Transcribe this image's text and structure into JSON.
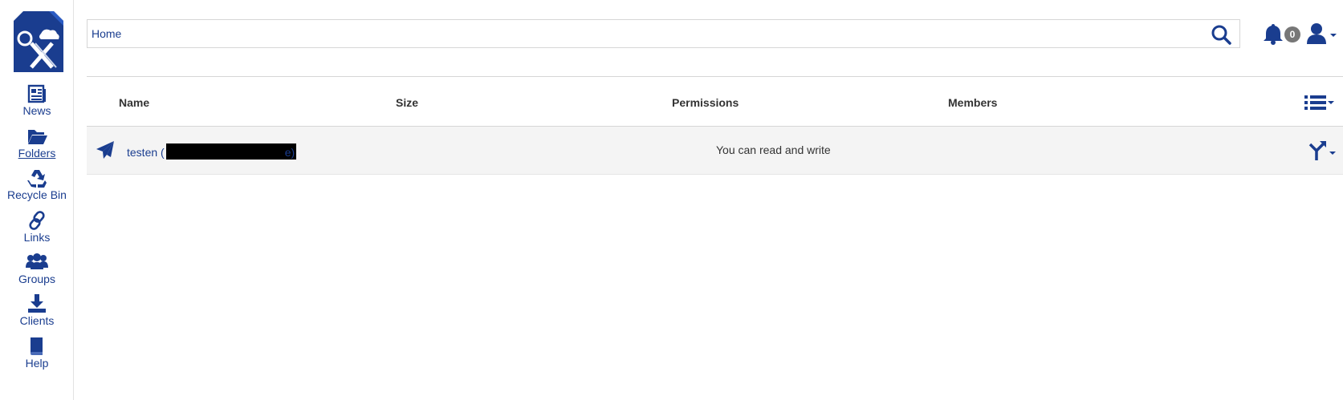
{
  "sidebar": {
    "logo_alt": "CX logo",
    "items": [
      {
        "label": "News",
        "icon": "news-icon"
      },
      {
        "label": "Folders",
        "icon": "folder-icon",
        "active": true
      },
      {
        "label": "Recycle Bin",
        "icon": "recycle-icon"
      },
      {
        "label": "Links",
        "icon": "link-icon"
      },
      {
        "label": "Groups",
        "icon": "groups-icon"
      },
      {
        "label": "Clients",
        "icon": "download-icon"
      },
      {
        "label": "Help",
        "icon": "book-icon"
      }
    ]
  },
  "header": {
    "breadcrumb_value": "Home",
    "notification_count": "0"
  },
  "table": {
    "columns": [
      "Name",
      "Size",
      "Permissions",
      "Members"
    ],
    "rows": [
      {
        "name_prefix": "testen (",
        "name_suffix": "e)",
        "size": "",
        "permissions": "You can read and write",
        "members": "",
        "icon": "paper-plane-icon"
      }
    ]
  },
  "colors": {
    "accent": "#1a3d8f",
    "row_bg": "#f4f4f4",
    "badge": "#777777"
  }
}
